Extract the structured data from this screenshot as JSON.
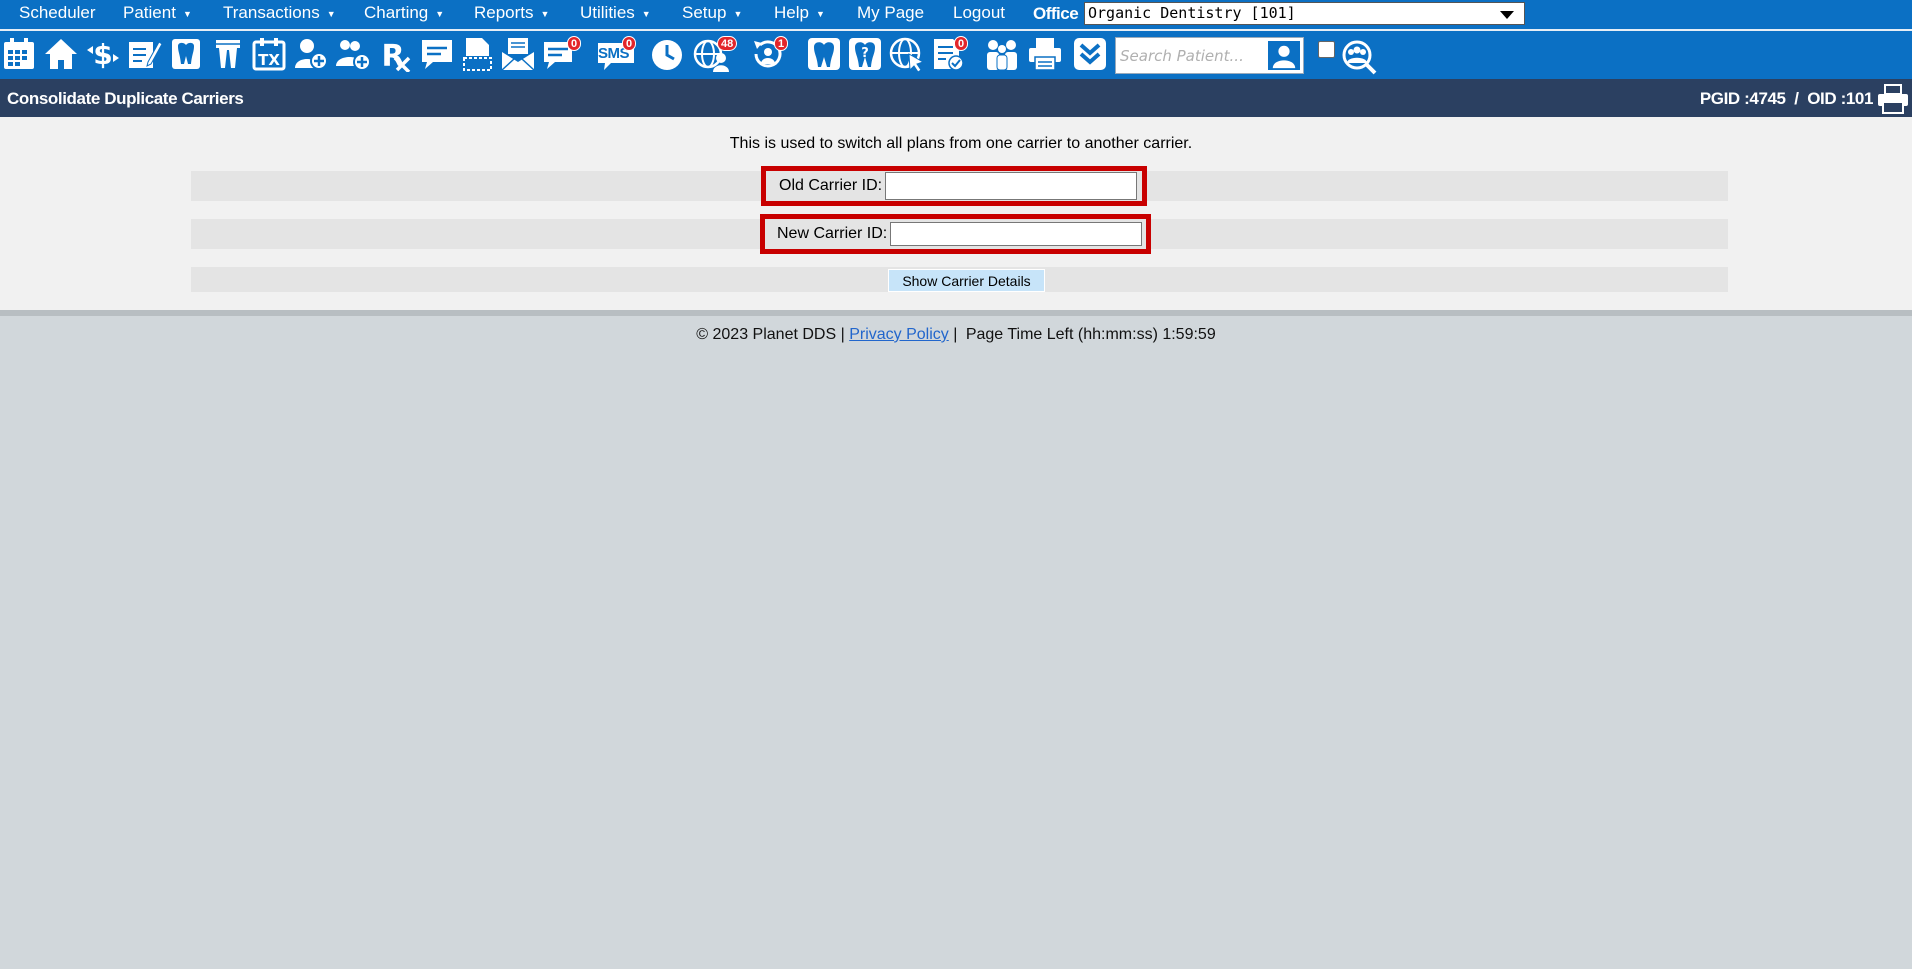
{
  "nav": {
    "items": [
      {
        "label": "Scheduler",
        "caret": false
      },
      {
        "label": "Patient",
        "caret": true
      },
      {
        "label": "Transactions",
        "caret": true
      },
      {
        "label": "Charting",
        "caret": true
      },
      {
        "label": "Reports",
        "caret": true
      },
      {
        "label": "Utilities",
        "caret": true
      },
      {
        "label": "Setup",
        "caret": true
      },
      {
        "label": "Help",
        "caret": true
      },
      {
        "label": "My Page",
        "caret": false
      },
      {
        "label": "Logout",
        "caret": false
      }
    ],
    "caret_glyph": "▼",
    "office_label": "Office",
    "office_value": "Organic Dentistry [101]"
  },
  "toolbar": {
    "icons": [
      "calendar-icon",
      "home-icon",
      "dollar-transfer-icon",
      "notes-edit-icon",
      "tooth-chart-icon",
      "perio-icon",
      "treatment-plan-icon",
      "add-patient-icon",
      "add-family-icon",
      "prescription-icon",
      "message-doc-icon",
      "documents-icon",
      "mail-icon",
      "chat-icon",
      "sms-icon",
      "clock-icon",
      "web-patients-icon",
      "recall-icon",
      "tooth-icon",
      "tooth-question-icon",
      "web-cursor-icon",
      "forms-icon",
      "family-icon",
      "printer-icon",
      "expand-icon"
    ],
    "badges": {
      "chat": "0",
      "sms": "0",
      "web_patients": "48",
      "recall": "1",
      "forms": "0"
    },
    "sms_text": "SMS",
    "search_placeholder": "Search Patient...",
    "colors": {
      "bar": "#0b70c4",
      "badge": "#e3262b"
    }
  },
  "header": {
    "title": "Consolidate Duplicate Carriers",
    "ids": "PGID :4745  /  OID :101"
  },
  "form": {
    "intro": "This is used to switch all plans from one carrier to another carrier.",
    "old_label": "Old Carrier ID:",
    "old_value": "",
    "new_label": "New Carrier ID:",
    "new_value": "",
    "button_label": "Show Carrier Details",
    "highlight_color": "#c80000"
  },
  "footer": {
    "copyright": "© 2023 Planet DDS |",
    "privacy_link": "Privacy Policy",
    "separator": "|",
    "time_text": "Page Time Left (hh:mm:ss) 1:59:59"
  }
}
